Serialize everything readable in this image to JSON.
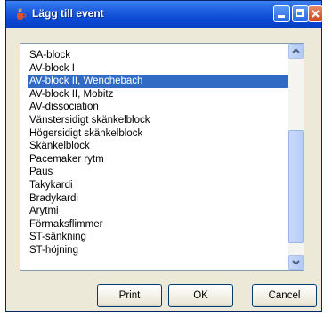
{
  "window": {
    "title": "Lägg till event",
    "title_icon": "java-cup-icon"
  },
  "list": {
    "items": [
      "SA-block",
      "AV-block I",
      "AV-block II, Wenchebach",
      "AV-block II, Mobitz",
      "AV-dissociation",
      "Vänstersidigt skänkelblock",
      "Högersidigt skänkelblock",
      "Skänkelblock",
      "Pacemaker rytm",
      "Paus",
      "Takykardi",
      "Bradykardi",
      "Arytmi",
      "Förmaksflimmer",
      "ST-sänkning",
      "ST-höjning"
    ],
    "selected_index": 2
  },
  "buttons": {
    "print": "Print",
    "ok": "OK",
    "cancel": "Cancel"
  },
  "colors": {
    "selection": "#316ac5",
    "titlebar": "#0a49d2",
    "dialog_bg": "#ece9d8"
  }
}
